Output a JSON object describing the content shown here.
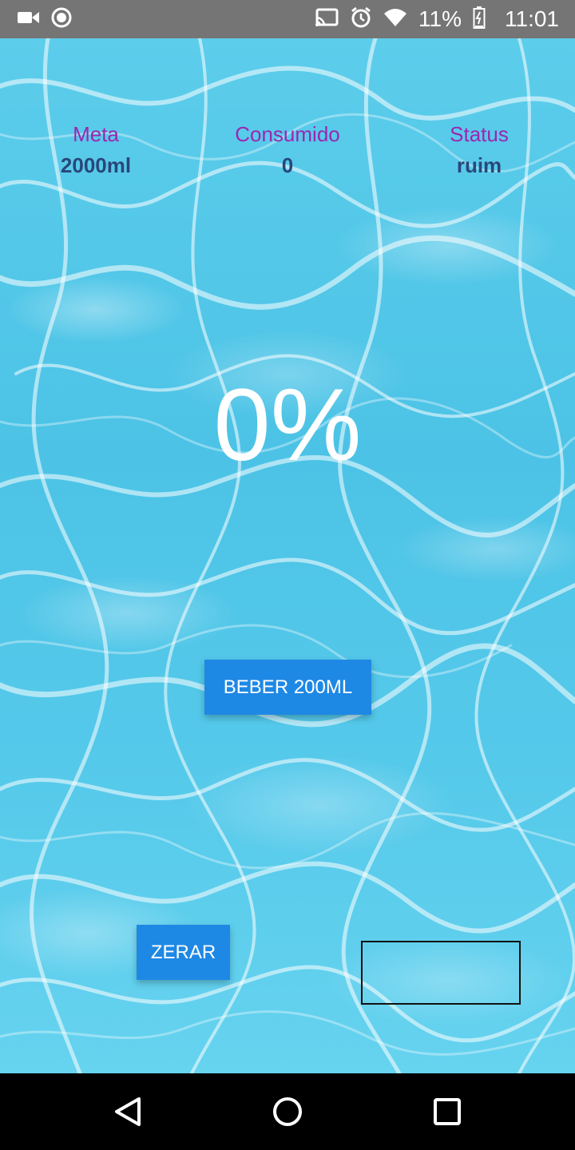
{
  "status_bar": {
    "icons_left": [
      "video-camera-icon",
      "record-icon"
    ],
    "icons_right": [
      "cast-icon",
      "alarm-icon",
      "wifi-icon"
    ],
    "battery": "11%",
    "time": "11:01"
  },
  "stats": {
    "meta": {
      "label": "Meta",
      "value": "2000ml"
    },
    "consumido": {
      "label": "Consumido",
      "value": "0"
    },
    "status": {
      "label": "Status",
      "value": "ruim"
    }
  },
  "progress": {
    "percent_text": "0%",
    "percent_value": 0
  },
  "buttons": {
    "beber": "BEBER 200ML",
    "zerar": "ZERAR"
  },
  "nav": {
    "icons": [
      "back-icon",
      "home-icon",
      "recents-icon"
    ]
  },
  "colors": {
    "label": "#9c27b0",
    "value": "#28477a",
    "button": "#1e88e5",
    "status_bar": "#757575"
  }
}
